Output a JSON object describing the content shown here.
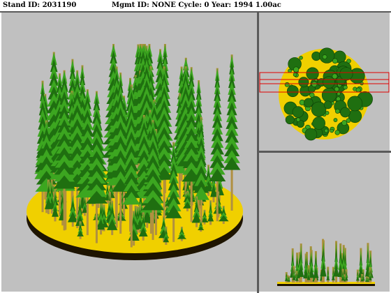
{
  "header": {
    "stand_text": "Stand ID: 2031190",
    "mgmt_text": "Mgmt ID: NONE Cycle: 0 Year: 1994 1.00ac"
  },
  "colors": {
    "background": "#c0c0c0",
    "ground": "#f0d000",
    "ground_edge": "#1e1400",
    "trunk": "#b09040",
    "foliage_dark": "#1f6f10",
    "foliage_light": "#3ca620",
    "selection": "#e00000"
  },
  "views": [
    "perspective-view",
    "top-view",
    "profile-view"
  ]
}
